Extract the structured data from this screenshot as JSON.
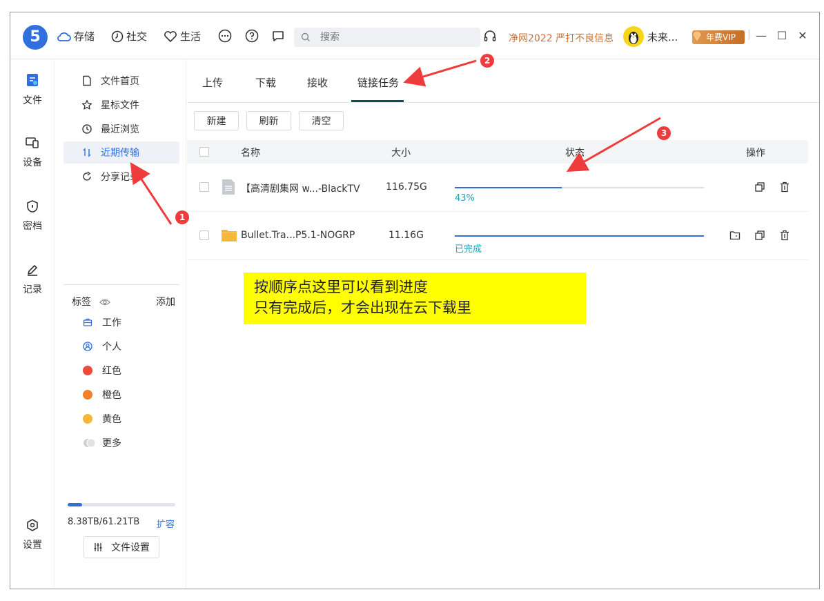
{
  "titlebar": {
    "logo_text": "5",
    "nav": [
      {
        "label": "存储",
        "icon": "cloud-icon"
      },
      {
        "label": "社交",
        "icon": "clock-icon"
      },
      {
        "label": "生活",
        "icon": "heart-icon"
      }
    ],
    "search_placeholder": "搜索",
    "promo": "净网2022 严打不良信息",
    "username": "未来...",
    "vip_label": "年费VIP",
    "window_controls": {
      "minimize": "—",
      "maximize": "☐",
      "close": "✕"
    }
  },
  "rail": [
    {
      "label": "文件",
      "icon": "file-icon",
      "active": true
    },
    {
      "label": "设备",
      "icon": "device-icon"
    },
    {
      "label": "密档",
      "icon": "safe-icon"
    },
    {
      "label": "记录",
      "icon": "pen-icon"
    },
    {
      "label": "设置",
      "icon": "settings-icon"
    }
  ],
  "sidebar": {
    "items": [
      {
        "label": "文件首页",
        "icon": "page-icon"
      },
      {
        "label": "星标文件",
        "icon": "star-icon"
      },
      {
        "label": "最近浏览",
        "icon": "history-icon"
      },
      {
        "label": "近期传输",
        "icon": "transfer-icon",
        "active": true
      },
      {
        "label": "分享记录",
        "icon": "share-icon"
      }
    ],
    "tags_title": "标签",
    "tags_add": "添加",
    "tags": [
      {
        "label": "工作",
        "color": "#2f6fde"
      },
      {
        "label": "个人",
        "color": "#2f6fde"
      },
      {
        "label": "红色",
        "color": "#f04a3a"
      },
      {
        "label": "橙色",
        "color": "#f0802a"
      },
      {
        "label": "黄色",
        "color": "#f6b73a"
      },
      {
        "label": "更多",
        "color": "#cfcfcf"
      }
    ],
    "storage": {
      "text": "8.38TB/61.21TB",
      "used_fraction": 0.137,
      "expand": "扩容"
    },
    "file_settings": "文件设置"
  },
  "tabs": [
    "上传",
    "下载",
    "接收",
    "链接任务"
  ],
  "buttons": {
    "new": "新建",
    "refresh": "刷新",
    "clear": "清空"
  },
  "table": {
    "headers": {
      "name": "名称",
      "size": "大小",
      "status": "状态",
      "ops": "操作"
    },
    "rows": [
      {
        "name": "【高清剧集网 w...-BlackTV",
        "size": "116.75G",
        "progress": 0.43,
        "status": "43%",
        "icon": "document-icon"
      },
      {
        "name": "Bullet.Tra...P5.1-NOGRP",
        "size": "11.16G",
        "progress": 1.0,
        "status": "已完成",
        "icon": "folder-icon"
      }
    ]
  },
  "annotation": {
    "line1": "按顺序点这里可以看到进度",
    "line2": "只有完成后，才会出现在云下载里",
    "badges": [
      "1",
      "2",
      "3"
    ]
  }
}
